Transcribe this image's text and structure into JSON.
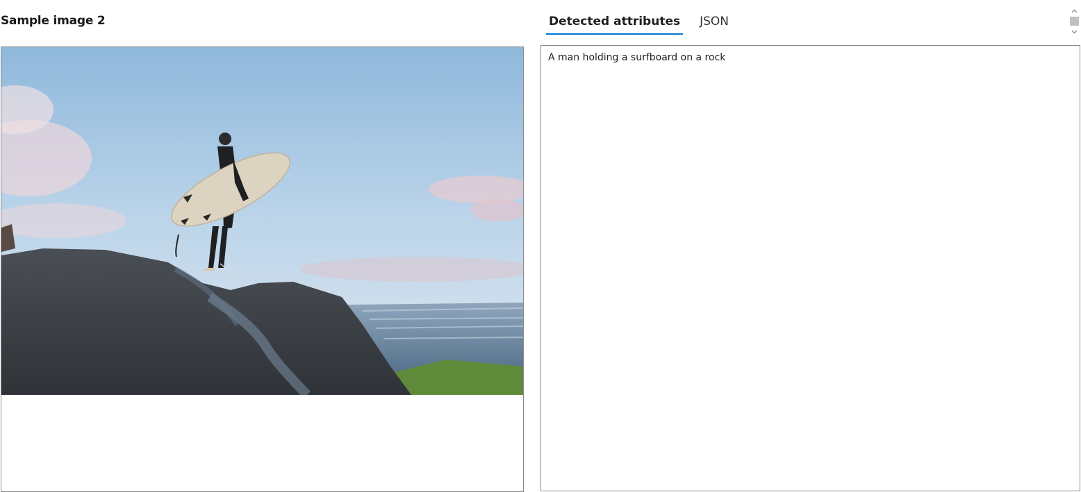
{
  "sample": {
    "title": "Sample image 2",
    "photo_alt": "Surfer holding a surfboard on a rock by the ocean"
  },
  "tabs": [
    {
      "label": "Detected attributes",
      "active": true
    },
    {
      "label": "JSON",
      "active": false
    }
  ],
  "result": {
    "caption": "A man holding a surfboard on a rock"
  },
  "icons": {
    "scroll_up": "chevron-up-icon",
    "scroll_down": "chevron-down-icon"
  }
}
